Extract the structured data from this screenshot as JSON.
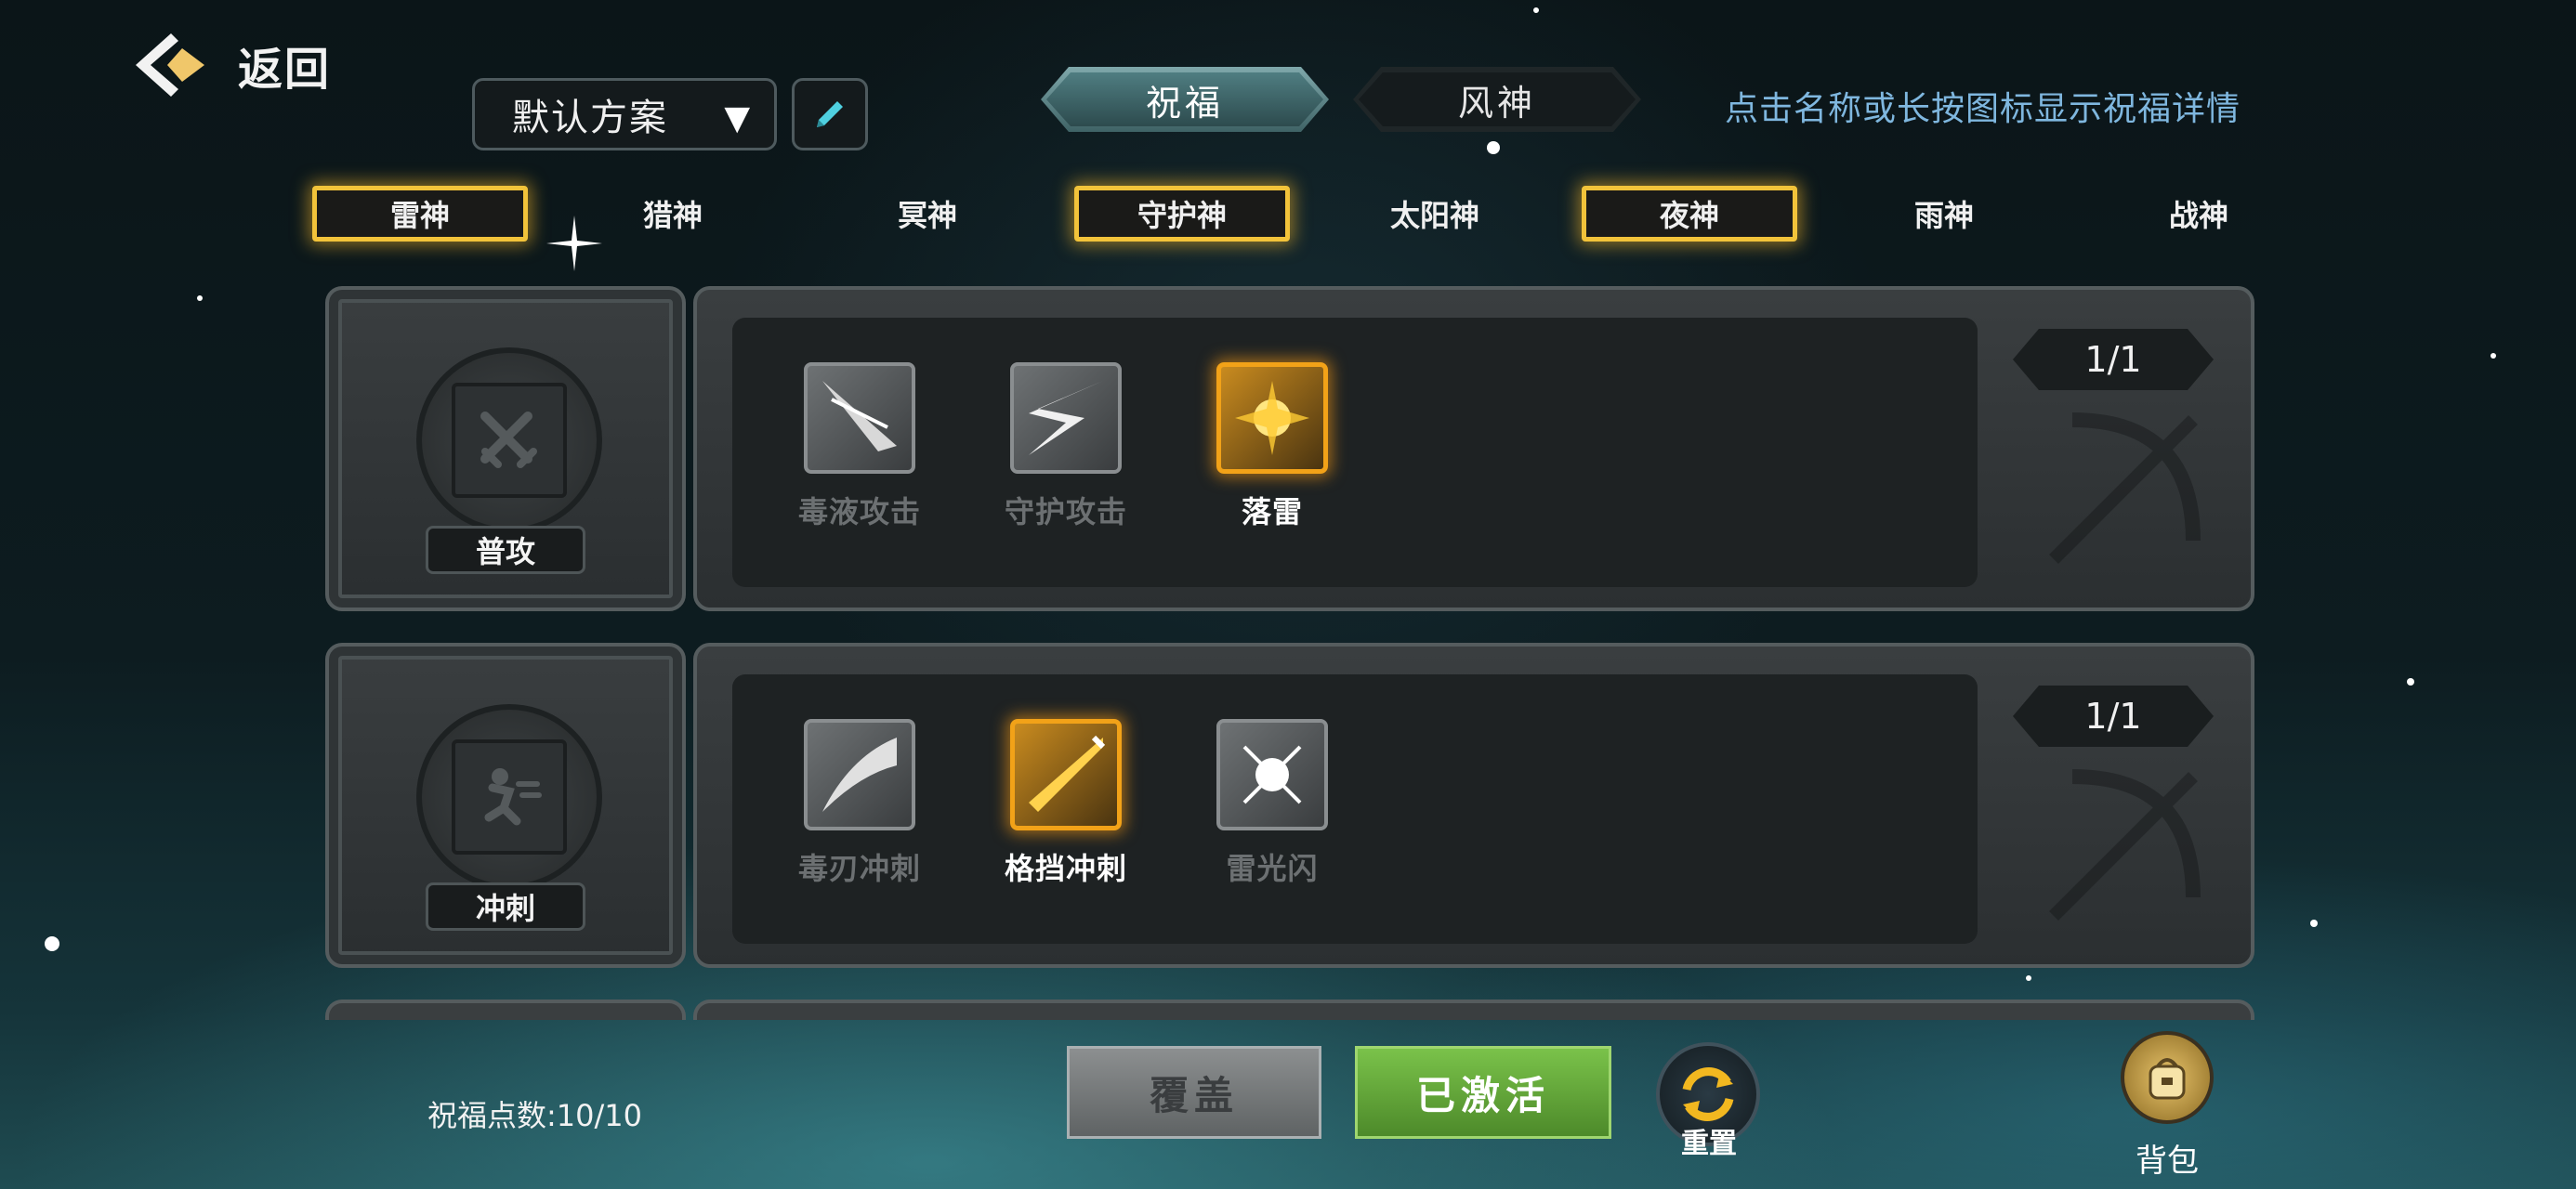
{
  "header": {
    "back_label": "返回",
    "preset_label": "默认方案",
    "hint": "点击名称或长按图标显示祝福详情"
  },
  "top_tabs": [
    {
      "label": "祝福",
      "active": true
    },
    {
      "label": "风神",
      "active": false
    }
  ],
  "god_tabs": [
    {
      "label": "雷神",
      "selected": true
    },
    {
      "label": "猎神",
      "selected": false
    },
    {
      "label": "冥神",
      "selected": false
    },
    {
      "label": "守护神",
      "selected": true
    },
    {
      "label": "太阳神",
      "selected": false
    },
    {
      "label": "夜神",
      "selected": true
    },
    {
      "label": "雨神",
      "selected": false
    },
    {
      "label": "战神",
      "selected": false
    }
  ],
  "rows": [
    {
      "slot_label": "普攻",
      "slot_icon": "crossed-swords-icon",
      "counter": "1/1",
      "skills": [
        {
          "name": "毒液攻击",
          "icon": "venom-strike-icon",
          "active": false
        },
        {
          "name": "守护攻击",
          "icon": "guard-strike-icon",
          "active": false
        },
        {
          "name": "落雷",
          "icon": "lightning-fall-icon",
          "active": true
        }
      ]
    },
    {
      "slot_label": "冲刺",
      "slot_icon": "dash-runner-icon",
      "counter": "1/1",
      "skills": [
        {
          "name": "毒刃冲刺",
          "icon": "venom-blade-dash-icon",
          "active": false
        },
        {
          "name": "格挡冲刺",
          "icon": "parry-dash-icon",
          "active": true
        },
        {
          "name": "雷光闪",
          "icon": "thunder-flash-icon",
          "active": false
        }
      ]
    }
  ],
  "footer": {
    "points_label": "祝福点数:10/10",
    "cover_label": "覆盖",
    "activated_label": "已激活",
    "reset_label": "重置",
    "bag_label": "背包"
  },
  "colors": {
    "accent_gold": "#f2c33a",
    "active_green": "#7ac24a",
    "hint_blue": "#7fb7df"
  }
}
